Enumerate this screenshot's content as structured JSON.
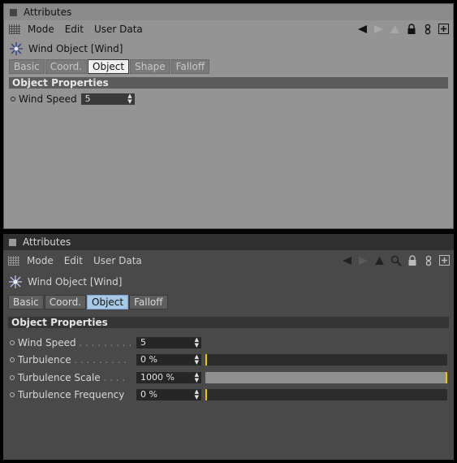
{
  "top": {
    "title": "Attributes",
    "menu": [
      "Mode",
      "Edit",
      "User Data"
    ],
    "object_name": "Wind Object [Wind]",
    "tabs": [
      "Basic",
      "Coord.",
      "Object",
      "Shape",
      "Falloff"
    ],
    "active_tab": "Object",
    "section_title": "Object Properties",
    "params": [
      {
        "label": "Wind Speed",
        "value": "5"
      }
    ]
  },
  "bottom": {
    "title": "Attributes",
    "menu": [
      "Mode",
      "Edit",
      "User Data"
    ],
    "object_name": "Wind Object [Wind]",
    "tabs": [
      "Basic",
      "Coord.",
      "Object",
      "Falloff"
    ],
    "active_tab": "Object",
    "section_title": "Object Properties",
    "params": [
      {
        "label": "Wind Speed",
        "value": "5"
      },
      {
        "label": "Turbulence",
        "value": "0 %",
        "slider_fraction": 0.0
      },
      {
        "label": "Turbulence Scale",
        "value": "1000 %",
        "slider_fraction": 1.0
      },
      {
        "label": "Turbulence Frequency",
        "value": "0 %",
        "slider_fraction": 0.0
      }
    ]
  },
  "icons": [
    "back-arrow-icon",
    "forward-arrow-icon",
    "up-arrow-icon",
    "search-icon",
    "lock-icon",
    "link-icon",
    "new-panel-icon",
    "wind-object-icon"
  ]
}
